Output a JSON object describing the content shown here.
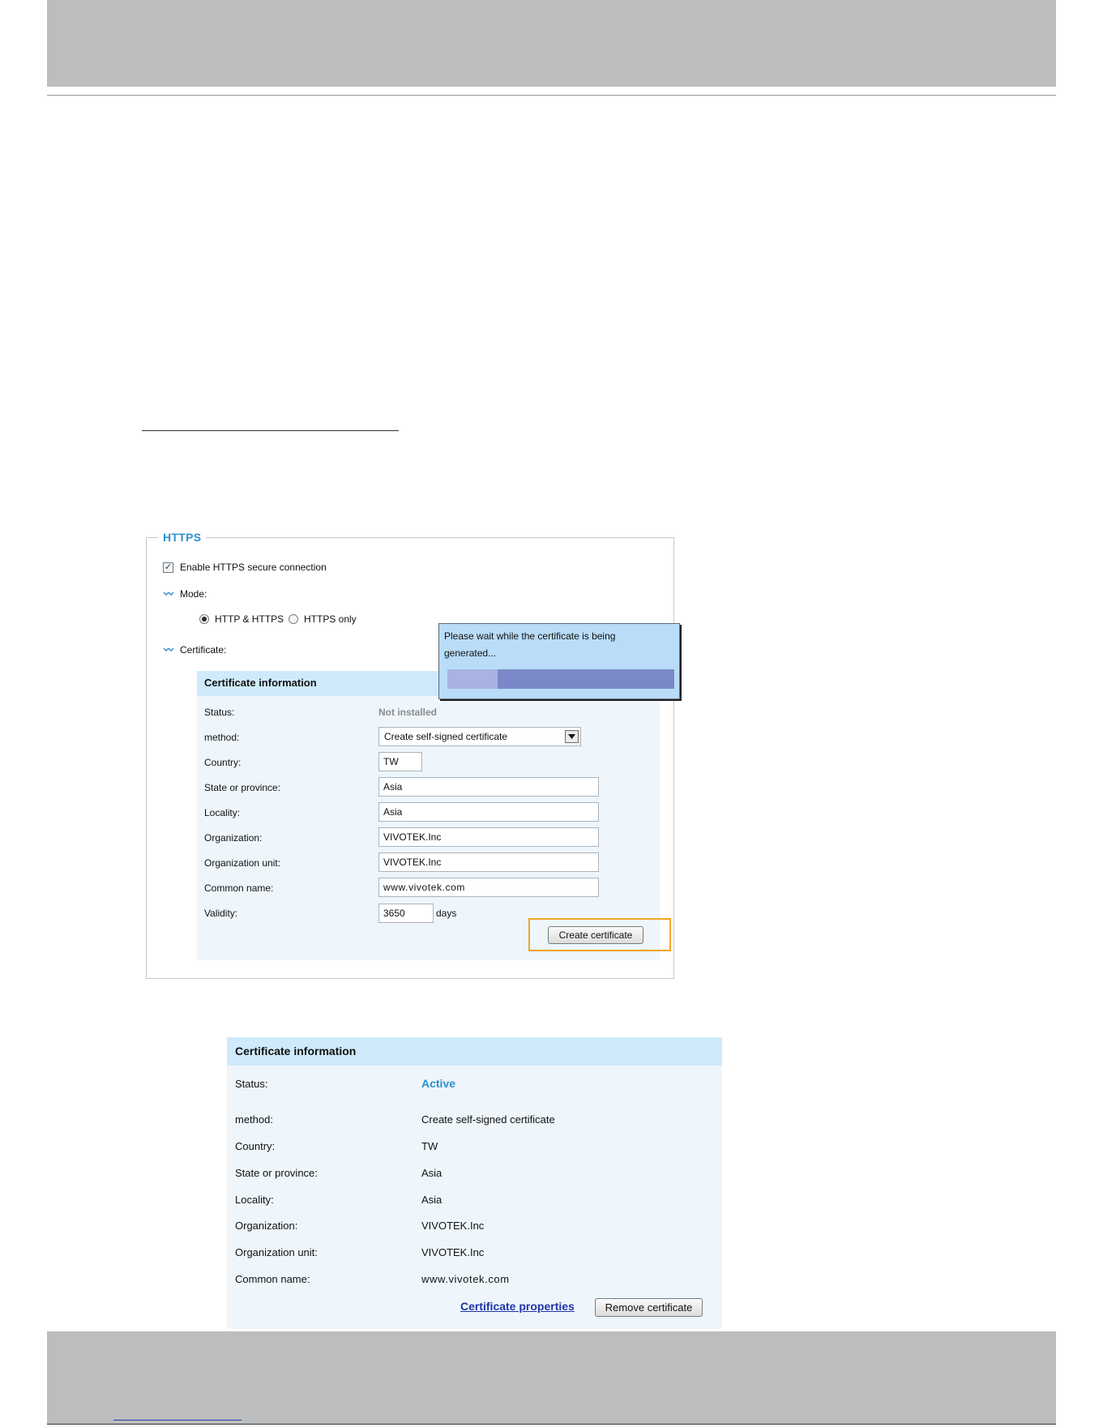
{
  "https": {
    "legend": "HTTPS",
    "enable_label": "Enable HTTPS secure connection",
    "enable_checked": true,
    "mode_label": "Mode:",
    "mode_options": [
      {
        "label": "HTTP & HTTPS",
        "selected": true
      },
      {
        "label": "HTTPS only",
        "selected": false
      }
    ],
    "certificate_label": "Certificate:"
  },
  "form": {
    "title": "Certificate information",
    "rows": [
      {
        "label": "Status:",
        "value": "Not installed"
      },
      {
        "label": "method:",
        "value": "Create self-signed certificate"
      },
      {
        "label": "Country:",
        "value": "TW"
      },
      {
        "label": "State or province:",
        "value": "Asia"
      },
      {
        "label": "Locality:",
        "value": "Asia"
      },
      {
        "label": "Organization:",
        "value": "VIVOTEK.Inc"
      },
      {
        "label": "Organization unit:",
        "value": "VIVOTEK.Inc"
      },
      {
        "label": "Common name:",
        "value": "www.vivotek.com"
      },
      {
        "label": "Validity:",
        "value": "3650"
      }
    ],
    "validity_unit": "days",
    "create_button": "Create certificate"
  },
  "popup": {
    "line1": "Please wait while the certificate is being",
    "line2": "generated...",
    "progress": 0.22
  },
  "result": {
    "title": "Certificate information",
    "rows": [
      {
        "label": "Status:",
        "value": "Active"
      },
      {
        "label": "method:",
        "value": "Create self-signed certificate"
      },
      {
        "label": "Country:",
        "value": "TW"
      },
      {
        "label": "State or province:",
        "value": "Asia"
      },
      {
        "label": "Locality:",
        "value": "Asia"
      },
      {
        "label": "Organization:",
        "value": "VIVOTEK.Inc"
      },
      {
        "label": "Organization unit:",
        "value": "VIVOTEK.Inc"
      },
      {
        "label": "Common name:",
        "value": "www.vivotek.com"
      }
    ],
    "properties_link": "Certificate properties",
    "remove_button": "Remove certificate"
  },
  "colors": {
    "accent": "#2e8fcf",
    "panel_header": "#cfeafa",
    "panel_body": "#eef6fb",
    "highlight": "#f0a623",
    "link": "#1f33a8"
  }
}
